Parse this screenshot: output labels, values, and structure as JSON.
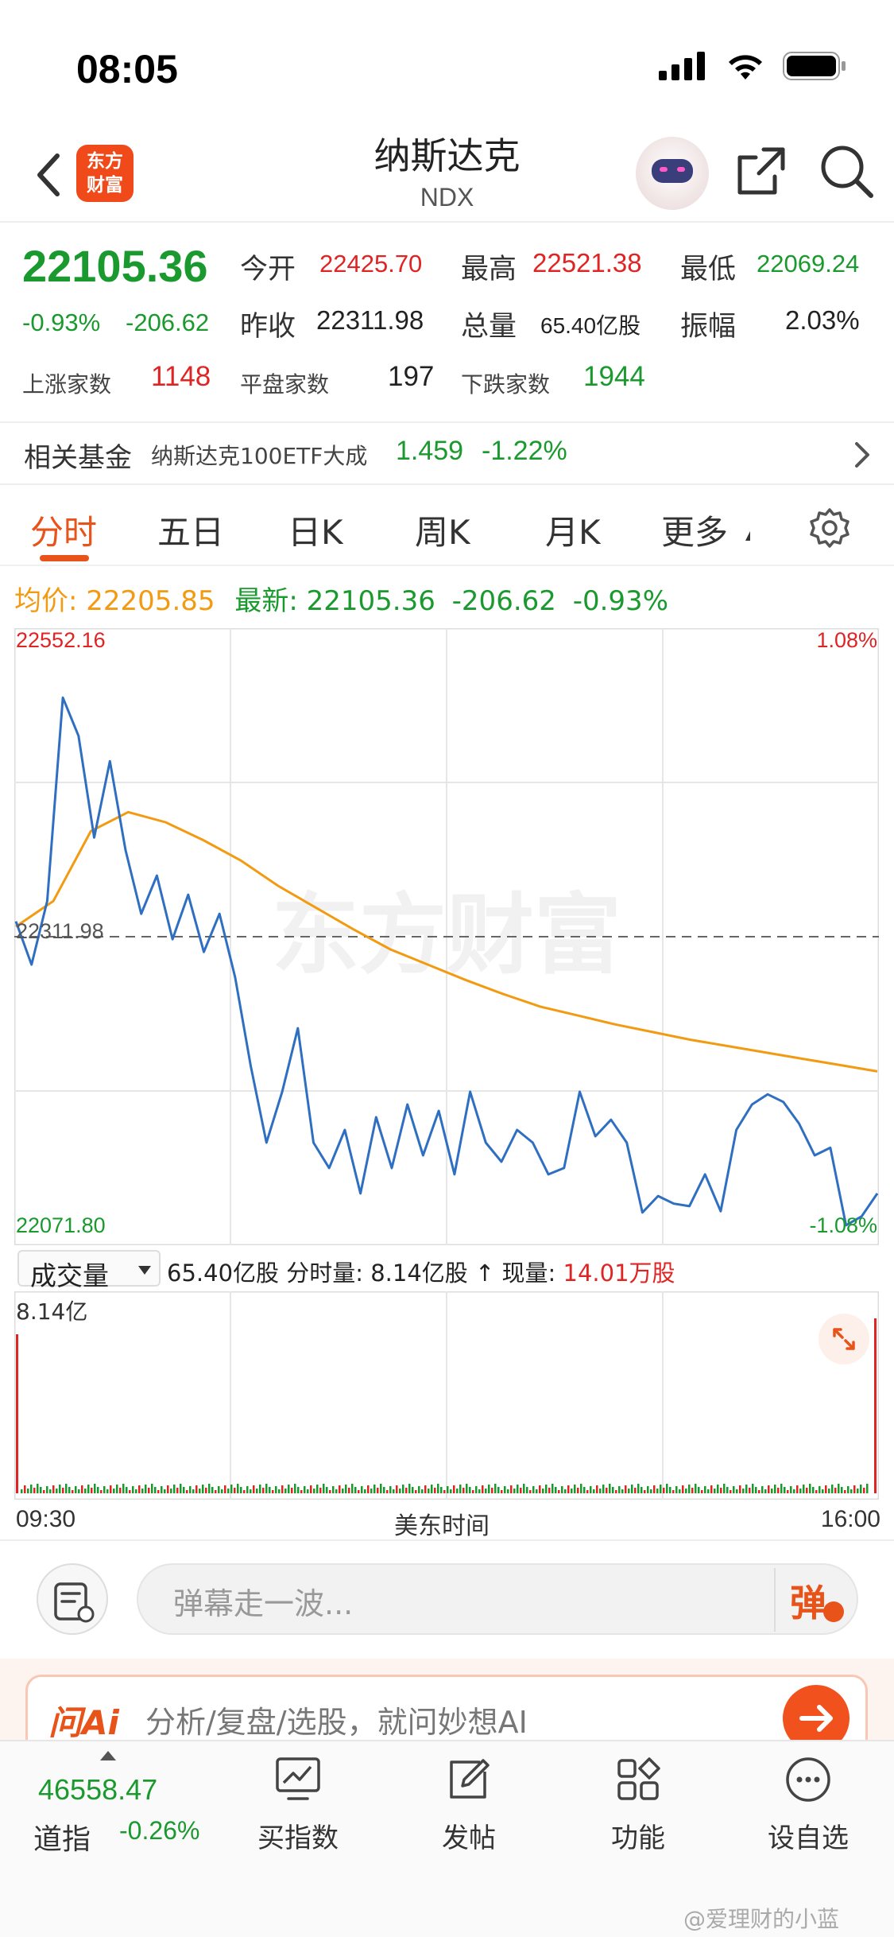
{
  "status_bar": {
    "time": "08:05"
  },
  "header": {
    "logo": "东方财富",
    "title": "纳斯达克",
    "subtitle": "NDX"
  },
  "quote": {
    "price": "22105.36",
    "change_pct": "-0.93%",
    "change": "-206.62",
    "open_label": "今开",
    "open": "22425.70",
    "high_label": "最高",
    "high": "22521.38",
    "low_label": "最低",
    "low": "22069.24",
    "prev_close_label": "昨收",
    "prev_close": "22311.98",
    "volume_label": "总量",
    "volume": "65.40亿股",
    "amplitude_label": "振幅",
    "amplitude": "2.03%",
    "up_label": "上涨家数",
    "up_count": "1148",
    "flat_label": "平盘家数",
    "flat_count": "197",
    "down_label": "下跌家数",
    "down_count": "1944"
  },
  "fund": {
    "label": "相关基金",
    "name": "纳斯达克100ETF大成",
    "price": "1.459",
    "change_pct": "-1.22%"
  },
  "tabs": [
    {
      "label": "分时",
      "active": true
    },
    {
      "label": "五日"
    },
    {
      "label": "日K"
    },
    {
      "label": "周K"
    },
    {
      "label": "月K"
    },
    {
      "label": "更多"
    }
  ],
  "avg_row": {
    "avg_label": "均价:",
    "avg_value": "22205.85",
    "latest_label": "最新:",
    "latest_value": "22105.36",
    "latest_change": "-206.62",
    "latest_pct": "-0.93%"
  },
  "chart_labels": {
    "max": "22552.16",
    "max_pct": "1.08%",
    "base": "22311.98",
    "min": "22071.80",
    "min_pct": "-1.08%",
    "watermark": "东方财富"
  },
  "volume": {
    "selector": "成交量",
    "text_a": "65.40亿股 分时量: 8.14亿股 ↑ 现量: ",
    "current": "14.01万股",
    "max_label": "8.14亿"
  },
  "time_axis": {
    "start": "09:30",
    "middle": "美东时间",
    "end": "16:00"
  },
  "comment": {
    "placeholder": "弹幕走一波...",
    "danmu": "弹"
  },
  "ai": {
    "logo": "问Ai",
    "text": "分析/复盘/选股，就问妙想AI"
  },
  "bottom_nav": {
    "index_value": "46558.47",
    "index_name": "道指",
    "index_pct": "-0.26%",
    "items": [
      {
        "label": "买指数",
        "icon": "chart-icon"
      },
      {
        "label": "发帖",
        "icon": "edit-icon"
      },
      {
        "label": "功能",
        "icon": "grid-icon"
      },
      {
        "label": "设自选",
        "icon": "more-icon"
      }
    ]
  },
  "credit": "@爱理财的小蓝",
  "colors": {
    "up": "#e02424",
    "down": "#1a9a2e",
    "accent": "#e8531a",
    "price_line": "#2f6fc2",
    "avg_line": "#f29b12"
  },
  "chart_data": {
    "type": "line",
    "title": "",
    "xlabel": "美东时间",
    "ylabel": "",
    "x_range": [
      "09:30",
      "16:00"
    ],
    "ylim": [
      22071.8,
      22552.16
    ],
    "baseline": 22311.98,
    "series": [
      {
        "name": "最新",
        "values": [
          22324,
          22290,
          22340,
          22500,
          22470,
          22390,
          22450,
          22380,
          22330,
          22360,
          22310,
          22345,
          22300,
          22330,
          22280,
          22210,
          22150,
          22190,
          22240,
          22150,
          22130,
          22160,
          22110,
          22170,
          22130,
          22180,
          22140,
          22175,
          22125,
          22190,
          22150,
          22135,
          22160,
          22150,
          22125,
          22130,
          22190,
          22155,
          22168,
          22150,
          22095,
          22108,
          22102,
          22100,
          22125,
          22096,
          22160,
          22180,
          22188,
          22182,
          22165,
          22140,
          22146,
          22085,
          22092,
          22110
        ]
      },
      {
        "name": "均价",
        "values": [
          22320,
          22340,
          22395,
          22410,
          22402,
          22388,
          22372,
          22352,
          22335,
          22318,
          22302,
          22290,
          22278,
          22267,
          22257,
          22250,
          22243,
          22237,
          22231,
          22226,
          22221,
          22216,
          22211,
          22206
        ]
      }
    ]
  }
}
